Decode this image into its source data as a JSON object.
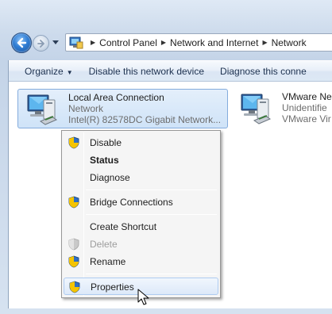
{
  "address_bar": {
    "crumbs": [
      "Control Panel",
      "Network and Internet",
      "Network"
    ]
  },
  "command_bar": {
    "organize": "Organize",
    "disable": "Disable this network device",
    "diagnose": "Diagnose this conne"
  },
  "connections": [
    {
      "name": "Local Area Connection",
      "status": "Network",
      "adapter": "Intel(R) 82578DC Gigabit Network...",
      "selected": true,
      "icon": "network-adapter-icon"
    },
    {
      "name": "VMware Ne",
      "status": "Unidentifie",
      "adapter": "VMware Vir",
      "selected": false,
      "icon": "network-adapter-icon"
    }
  ],
  "context_menu": {
    "items": [
      {
        "label": "Disable",
        "shield": true,
        "bold": false,
        "disabled": false
      },
      {
        "label": "Status",
        "shield": false,
        "bold": true,
        "disabled": false
      },
      {
        "label": "Diagnose",
        "shield": false,
        "bold": false,
        "disabled": false
      },
      {
        "label": "Bridge Connections",
        "shield": true,
        "bold": false,
        "disabled": false
      },
      {
        "label": "Create Shortcut",
        "shield": false,
        "bold": false,
        "disabled": false
      },
      {
        "label": "Delete",
        "shield": true,
        "bold": false,
        "disabled": true
      },
      {
        "label": "Rename",
        "shield": true,
        "bold": false,
        "disabled": false
      },
      {
        "label": "Properties",
        "shield": true,
        "bold": false,
        "disabled": false,
        "hovered": true
      }
    ]
  },
  "colors": {
    "selection_fill": "#cfe3f8",
    "selection_border": "#84acdd",
    "command_text": "#1e3250",
    "disabled_text": "#9d9d9d"
  }
}
